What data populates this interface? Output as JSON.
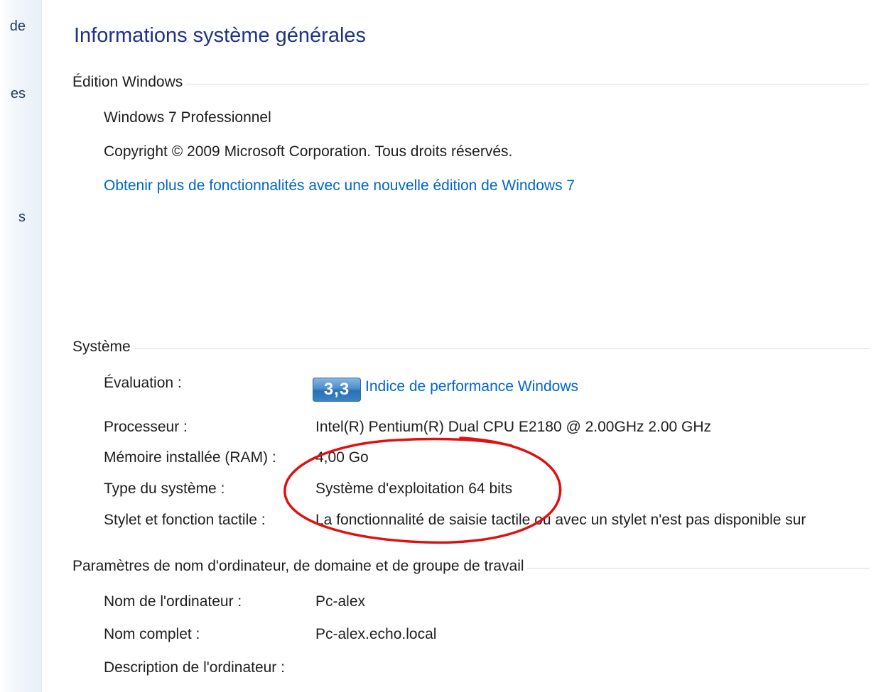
{
  "nav": {
    "fragments": [
      "de",
      "es",
      "s"
    ]
  },
  "page": {
    "title": "Informations système générales"
  },
  "edition": {
    "header": "Édition Windows",
    "name": "Windows 7 Professionnel",
    "copyright": "Copyright © 2009 Microsoft Corporation. Tous droits réservés.",
    "upgrade_link": "Obtenir plus de fonctionnalités avec une nouvelle édition de Windows 7"
  },
  "system": {
    "header": "Système",
    "rating_label": "Évaluation :",
    "rating_score": "3,3",
    "rating_link": "Indice de performance Windows",
    "rows": [
      {
        "label": "Processeur :",
        "value": "Intel(R) Pentium(R) Dual  CPU  E2180  @ 2.00GHz   2.00 GHz"
      },
      {
        "label": "Mémoire installée (RAM) :",
        "value": "4,00 Go"
      },
      {
        "label": "Type du système :",
        "value": "Système d'exploitation 64 bits"
      },
      {
        "label": "Stylet et fonction tactile :",
        "value": "La fonctionnalité de saisie tactile ou avec un stylet n'est pas disponible sur"
      }
    ]
  },
  "computer": {
    "header": "Paramètres de nom d'ordinateur, de domaine et de groupe de travail",
    "rows": [
      {
        "label": "Nom de l'ordinateur :",
        "value": "Pc-alex"
      },
      {
        "label": "Nom complet :",
        "value": "Pc-alex.echo.local"
      },
      {
        "label": "Description de l'ordinateur :",
        "value": ""
      }
    ]
  },
  "colors": {
    "title": "#1e3287",
    "link": "#0066cc",
    "annotation": "#e01010"
  }
}
